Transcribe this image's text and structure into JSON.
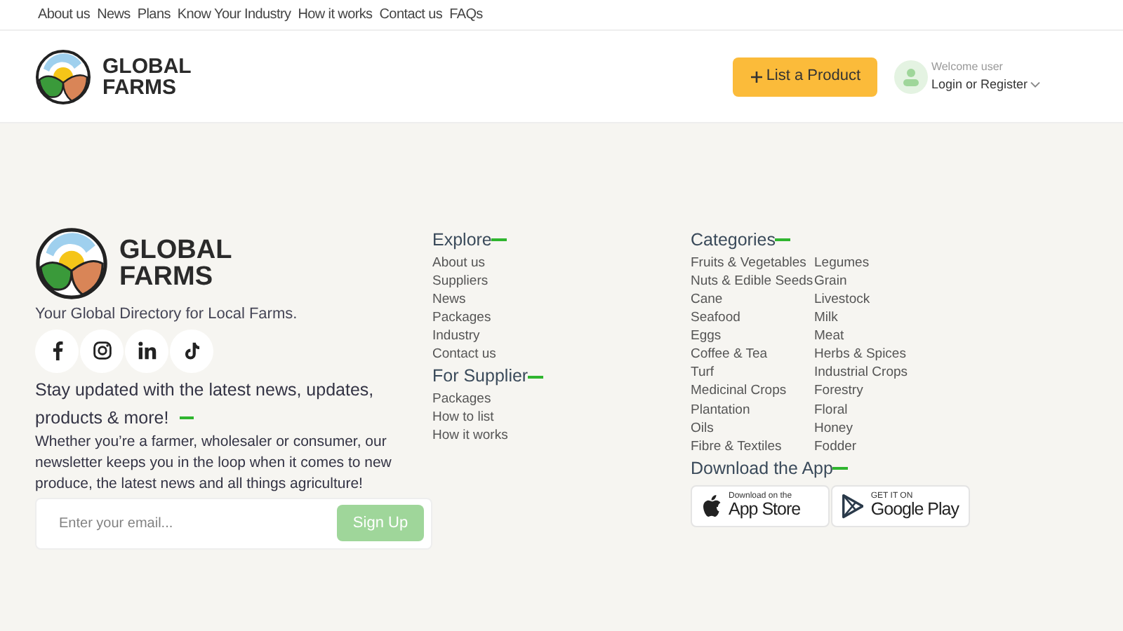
{
  "top_nav": [
    "About us",
    "News",
    "Plans",
    "Know Your Industry",
    "How it works",
    "Contact us",
    "FAQs"
  ],
  "header": {
    "logo_text": [
      "GLOBAL",
      "FARMS"
    ],
    "list_button": "List a Product",
    "welcome": "Welcome user",
    "login": "Login or Register"
  },
  "footer": {
    "logo_text": [
      "GLOBAL",
      "FARMS"
    ],
    "tagline": "Your Global Directory for Local Farms.",
    "socials": [
      {
        "kind": "facebook"
      },
      {
        "kind": "instagram"
      },
      {
        "kind": "linkedin"
      },
      {
        "kind": "tiktok"
      }
    ],
    "newsletter_title": "Stay updated with the latest news, updates, products & more!",
    "newsletter_text": "Whether you’re a farmer, wholesaler or consumer, our newsletter keeps you in the loop when it comes to new produce, the latest news and all things agriculture!",
    "email_placeholder": "Enter your email...",
    "signup": "Sign Up",
    "explore": {
      "title": "Explore",
      "links": [
        "About us",
        "Suppliers",
        "News",
        "Packages",
        "Industry",
        "Contact us"
      ]
    },
    "supplier": {
      "title": "For Supplier",
      "links": [
        "Packages",
        "How to list",
        "How it works"
      ]
    },
    "categories": {
      "title": "Categories",
      "links": [
        "Fruits & Vegetables",
        "Legumes",
        "Nuts & Edible Seeds",
        "Grain",
        "Cane",
        "Livestock",
        "Seafood",
        "Milk",
        "Eggs",
        "Meat",
        "Coffee & Tea",
        "Herbs & Spices",
        "Turf",
        "Industrial Crops",
        "Medicinal Crops",
        "Forestry",
        "Plantation",
        "Floral",
        "Oils",
        "Honey",
        "Fibre & Textiles",
        "Fodder"
      ]
    },
    "app": {
      "title": "Download the App",
      "badges": [
        {
          "kind": "apple",
          "small": "Download on the",
          "big": "App Store"
        },
        {
          "kind": "google",
          "small": "GET IT ON",
          "big": "Google Play"
        }
      ]
    }
  }
}
